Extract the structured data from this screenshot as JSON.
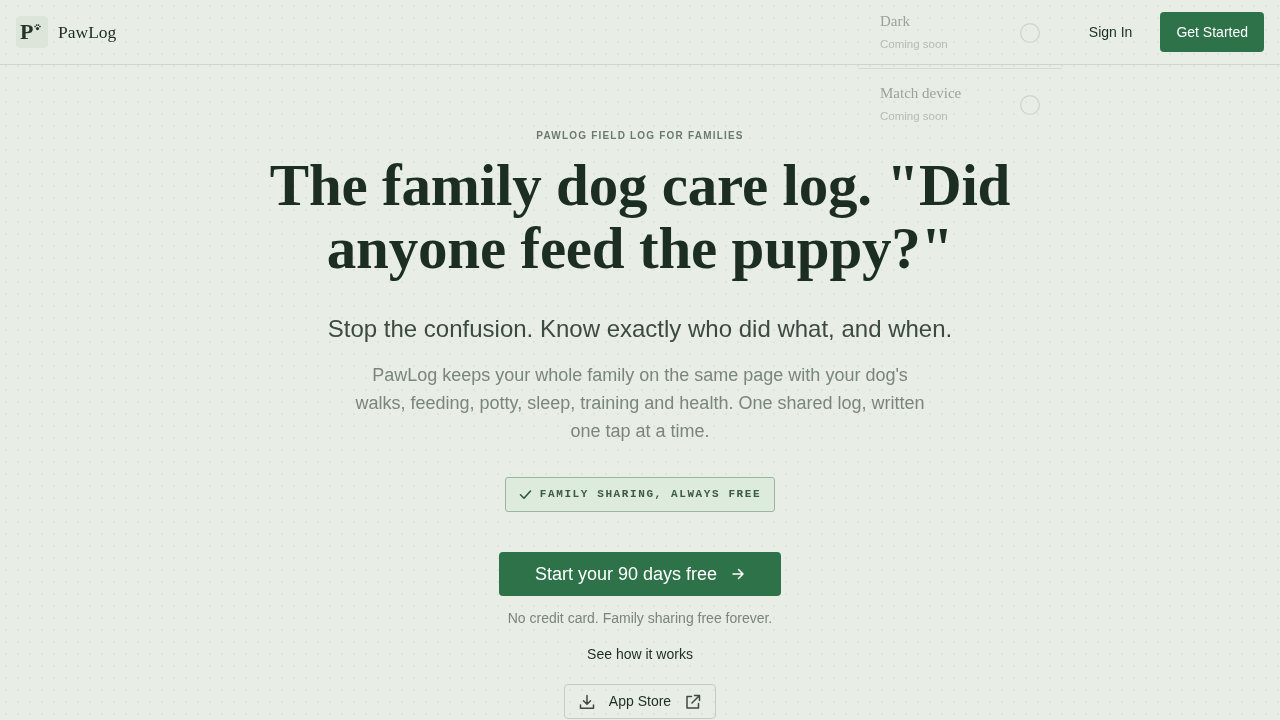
{
  "header": {
    "logo_mark": "P",
    "logo_text": "PawLog",
    "nav": [
      {
        "label": "Sign In",
        "kind": "link"
      },
      {
        "label": "Get Started",
        "kind": "button"
      }
    ]
  },
  "theme_menu": {
    "options": [
      {
        "label": "Dark",
        "note": "Coming soon",
        "selected": false,
        "disabled": true
      },
      {
        "label": "Match device",
        "note": "Coming soon",
        "selected": false,
        "disabled": true
      }
    ]
  },
  "hero": {
    "eyebrow": "PAWLOG FIELD LOG FOR FAMILIES",
    "headline": "The family dog care log. \"Did anyone feed the puppy?\"",
    "subheadline": "Stop the confusion. Know exactly who did what, and when.",
    "description": "PawLog keeps your whole family on the same page with your dog's walks, feeding, potty, sleep, training and health. One shared log, written one tap at a time.",
    "badge": "FAMILY SHARING, ALWAYS FREE",
    "cta": "Start your 90 days free",
    "cta_note": "No credit card. Family sharing free forever.",
    "secondary_link": "See how it works",
    "store_button": "App Store"
  }
}
